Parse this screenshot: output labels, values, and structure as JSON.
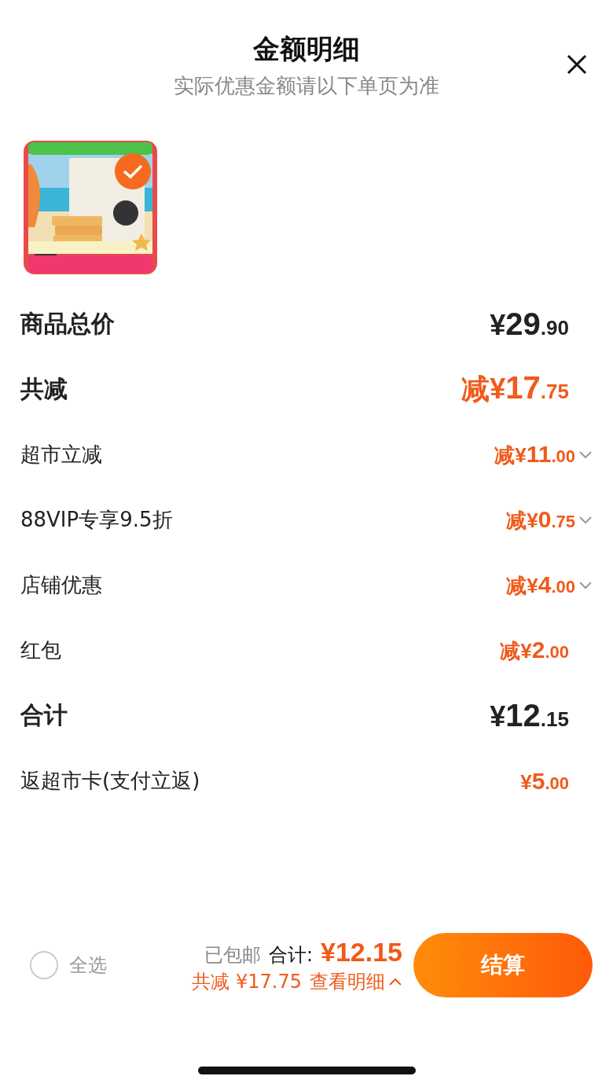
{
  "header": {
    "title": "金额明细",
    "subtitle": "实际优惠金额请以下单页为准"
  },
  "product": {
    "kind": "picture",
    "selected": true
  },
  "rows": [
    {
      "kind": "total",
      "label": "商品总价",
      "prefix": "",
      "amount": "¥29.90",
      "expandable": false
    },
    {
      "kind": "discount_total",
      "label": "共减",
      "prefix": "减",
      "amount": "¥17.75",
      "expandable": false
    },
    {
      "kind": "item",
      "label": "超市立减",
      "prefix": "减",
      "amount": "¥11.00",
      "expandable": true
    },
    {
      "kind": "item",
      "label": "88VIP专享9.5折",
      "prefix": "减",
      "amount": "¥0.75",
      "expandable": true
    },
    {
      "kind": "item",
      "label": "店铺优惠",
      "prefix": "减",
      "amount": "¥4.00",
      "expandable": true
    },
    {
      "kind": "item",
      "label": "红包",
      "prefix": "减",
      "amount": "¥2.00",
      "expandable": false
    },
    {
      "kind": "total",
      "label": "合计",
      "prefix": "",
      "amount": "¥12.15",
      "expandable": false
    },
    {
      "kind": "item",
      "label": "返超市卡(支付立返)",
      "prefix": "",
      "amount": "¥5.00",
      "expandable": false
    }
  ],
  "footer": {
    "select_all": {
      "label": "全选",
      "checked": false
    },
    "shipping": "已包邮",
    "total_label": "合计:",
    "total": "¥12.15",
    "saved": "共减 ¥17.75",
    "details_link": "查看明细",
    "details_expanded": true,
    "checkout": "结算"
  }
}
